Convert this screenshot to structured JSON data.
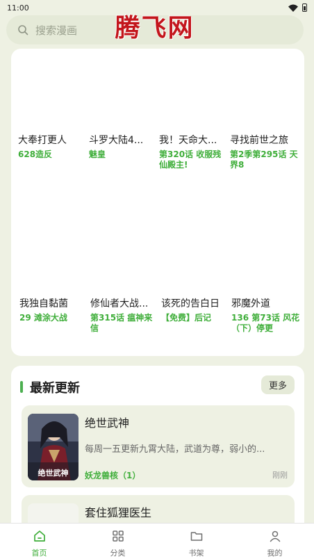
{
  "status_bar": {
    "time": "11:00"
  },
  "search": {
    "placeholder": "搜索漫画"
  },
  "logo": {
    "text": "腾飞网"
  },
  "featured": [
    {
      "title": "大奉打更人",
      "subtitle": "628造反"
    },
    {
      "title": "斗罗大陆4...",
      "subtitle": "魅皇"
    },
    {
      "title": "我！天命大...",
      "subtitle": "第320话 收服残仙殿主!"
    },
    {
      "title": "寻找前世之旅",
      "subtitle": "第2季第295话 天界8"
    },
    {
      "title": "我独自黏菌",
      "subtitle": "29 滩涂大战"
    },
    {
      "title": "修仙者大战...",
      "subtitle": "第315话 瘟神来信"
    },
    {
      "title": "该死的告白日",
      "subtitle": "【免费】后记"
    },
    {
      "title": "邪魔外道",
      "subtitle": "136 第73话 风花（下）停更"
    }
  ],
  "latest": {
    "title": "最新更新",
    "more_label": "更多",
    "items": [
      {
        "title": "绝世武神",
        "cover_text": "绝世武神",
        "description": "每周一五更新九霄大陆，武道为尊，弱小的...",
        "chapter": "妖龙兽核（1）",
        "time": "刚刚"
      },
      {
        "title": "套住狐狸医生"
      }
    ]
  },
  "nav": [
    {
      "label": "首页",
      "icon": "home-icon",
      "active": true
    },
    {
      "label": "分类",
      "icon": "grid-icon",
      "active": false
    },
    {
      "label": "书架",
      "icon": "folder-icon",
      "active": false
    },
    {
      "label": "我的",
      "icon": "user-icon",
      "active": false
    }
  ],
  "colors": {
    "accent": "#3fae3a",
    "logo": "#c3161c",
    "background": "#eef1e3"
  }
}
